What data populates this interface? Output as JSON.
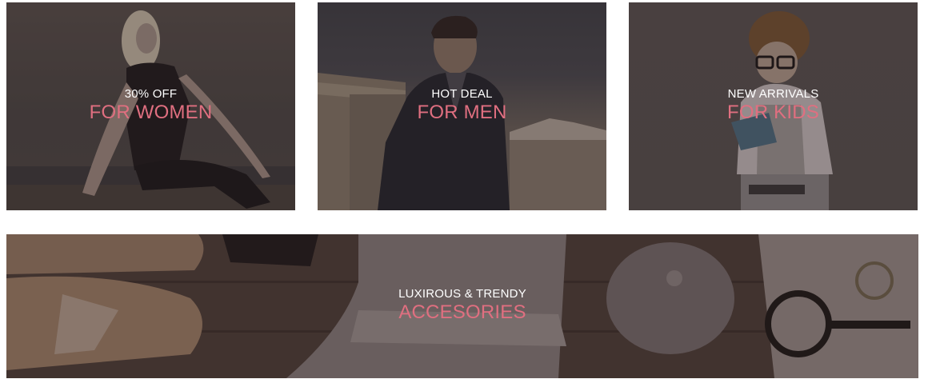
{
  "banners": {
    "women": {
      "subtitle": "30% OFF",
      "title": "FOR WOMEN"
    },
    "men": {
      "subtitle": "HOT DEAL",
      "title": "FOR MEN"
    },
    "kids": {
      "subtitle": "NEW ARRIVALS",
      "title": "FOR KIDS"
    },
    "accessories": {
      "subtitle": "LUXIROUS & TRENDY",
      "title": "ACCESORIES"
    }
  },
  "colors": {
    "accent": "#e06f80",
    "subtitle": "#ffffff"
  },
  "images": {
    "women": "woman-sitting-photo",
    "men": "man-in-suit-photo",
    "kids": "boy-with-glasses-photo",
    "accessories": "shoes-hat-bag-flatlay-photo"
  }
}
